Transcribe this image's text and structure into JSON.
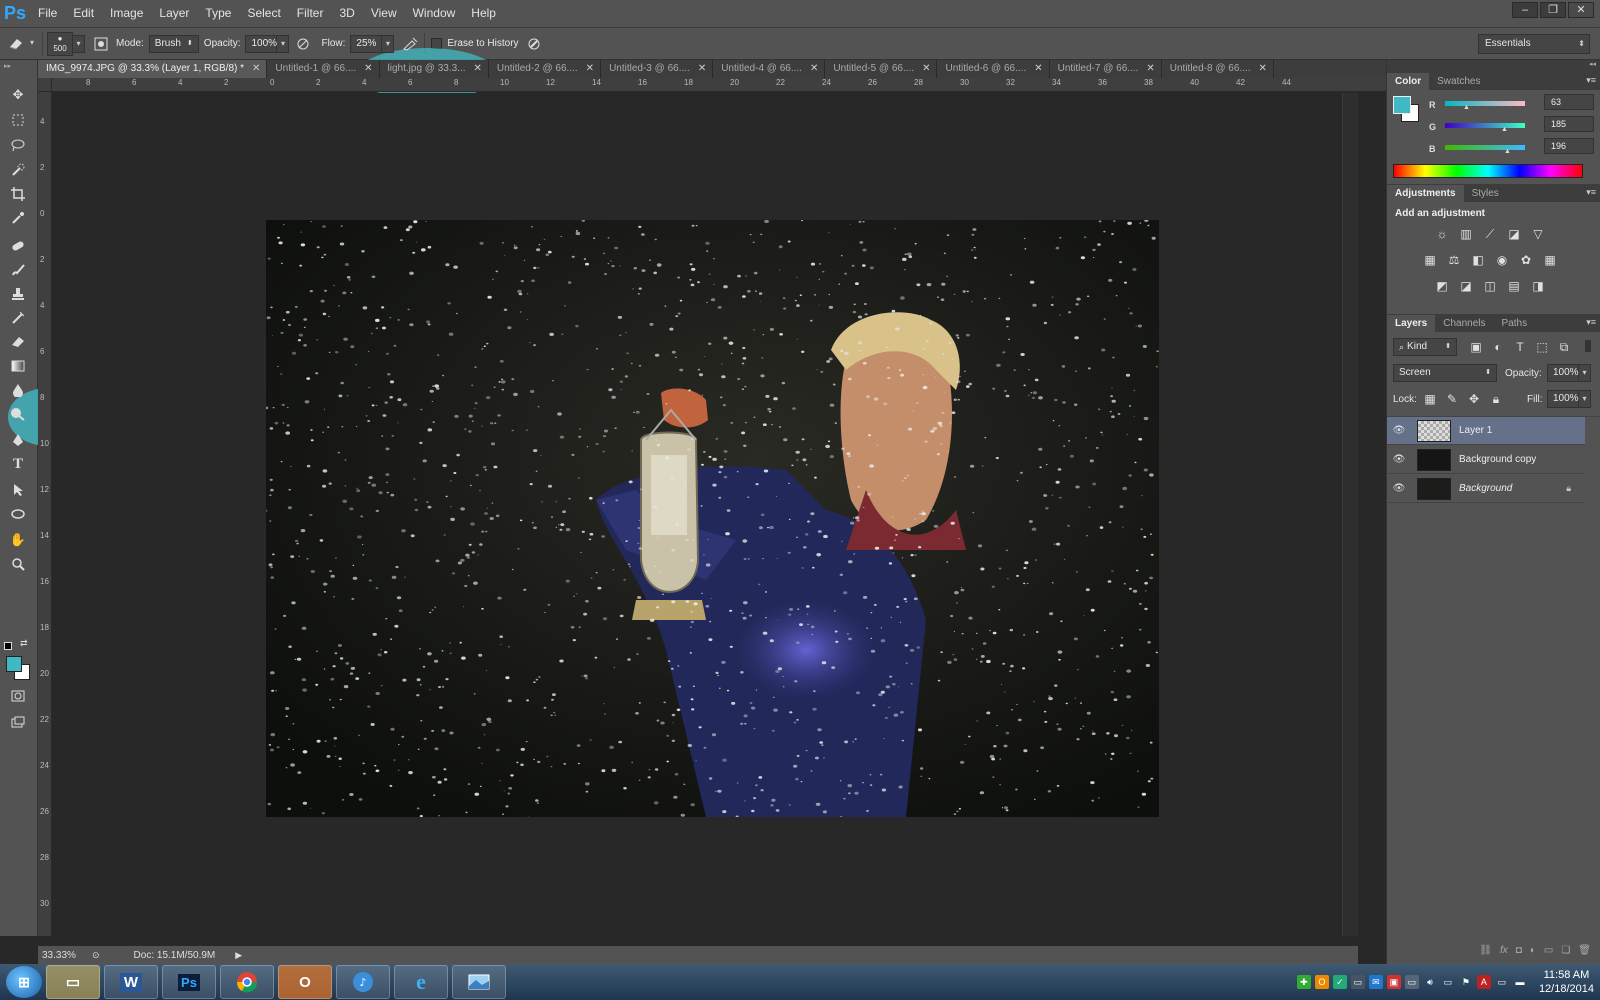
{
  "app": {
    "logo": "Ps"
  },
  "menu": [
    "File",
    "Edit",
    "Image",
    "Layer",
    "Type",
    "Select",
    "Filter",
    "3D",
    "View",
    "Window",
    "Help"
  ],
  "options": {
    "brush_size": "500",
    "mode_label": "Mode:",
    "mode_value": "Brush",
    "opacity_label": "Opacity:",
    "opacity_value": "100%",
    "flow_label": "Flow:",
    "flow_value": "25%",
    "erase_history_label": "Erase to History",
    "workspace": "Essentials"
  },
  "tabs": [
    {
      "label": "IMG_9974.JPG @ 33.3% (Layer 1, RGB/8) *",
      "active": true
    },
    {
      "label": "Untitled-1 @ 66...."
    },
    {
      "label": "light.jpg @ 33.3..."
    },
    {
      "label": "Untitled-2 @ 66...."
    },
    {
      "label": "Untitled-3 @ 66...."
    },
    {
      "label": "Untitled-4 @ 66...."
    },
    {
      "label": "Untitled-5 @ 66...."
    },
    {
      "label": "Untitled-6 @ 66...."
    },
    {
      "label": "Untitled-7 @ 66...."
    },
    {
      "label": "Untitled-8 @ 66...."
    }
  ],
  "ruler_top": [
    "8",
    "6",
    "4",
    "2",
    "0",
    "2",
    "4",
    "6",
    "8",
    "10",
    "12",
    "14",
    "16",
    "18",
    "20",
    "22",
    "24",
    "26",
    "28",
    "30",
    "32",
    "34",
    "36",
    "38",
    "40",
    "42",
    "44"
  ],
  "ruler_left": [
    "4",
    "2",
    "0",
    "2",
    "4",
    "6",
    "8",
    "10",
    "12",
    "14",
    "16",
    "18",
    "20",
    "22",
    "24",
    "26",
    "28",
    "30"
  ],
  "status": {
    "zoom": "33.33%",
    "doc": "Doc: 15.1M/50.9M"
  },
  "color_panel": {
    "tabs": [
      "Color",
      "Swatches"
    ],
    "foreground_color": "#3fb9c4",
    "r_label": "R",
    "r": "63",
    "g_label": "G",
    "g": "185",
    "b_label": "B",
    "b": "196"
  },
  "adjustments_panel": {
    "tabs": [
      "Adjustments",
      "Styles"
    ],
    "heading": "Add an adjustment",
    "icons": [
      "brightness-icon",
      "levels-icon",
      "curves-icon",
      "exposure-icon",
      "gradient-triangle-icon",
      "vibrance-icon",
      "color-balance-icon",
      "black-white-icon",
      "photo-filter-icon",
      "channel-mixer-icon",
      "color-lookup-icon",
      "invert-icon",
      "posterize-icon",
      "threshold-icon",
      "gradient-map-icon",
      "selective-color-icon"
    ]
  },
  "layers_panel": {
    "tabs": [
      "Layers",
      "Channels",
      "Paths"
    ],
    "kind_label": "Kind",
    "blend_mode": "Screen",
    "opacity_label": "Opacity:",
    "opacity_value": "100%",
    "lock_label": "Lock:",
    "fill_label": "Fill:",
    "fill_value": "100%",
    "layers": [
      {
        "name": "Layer 1",
        "selected": true
      },
      {
        "name": "Background copy"
      },
      {
        "name": "Background",
        "locked": true
      }
    ]
  },
  "taskbar": {
    "apps": [
      "explorer-icon",
      "word-icon",
      "photoshop-icon",
      "chrome-icon",
      "outlook-icon",
      "itunes-icon",
      "ie-icon",
      "photo-viewer-icon"
    ],
    "word_glyph": "W",
    "ps_glyph": "Ps",
    "time": "11:58 AM",
    "date": "12/18/2014"
  }
}
